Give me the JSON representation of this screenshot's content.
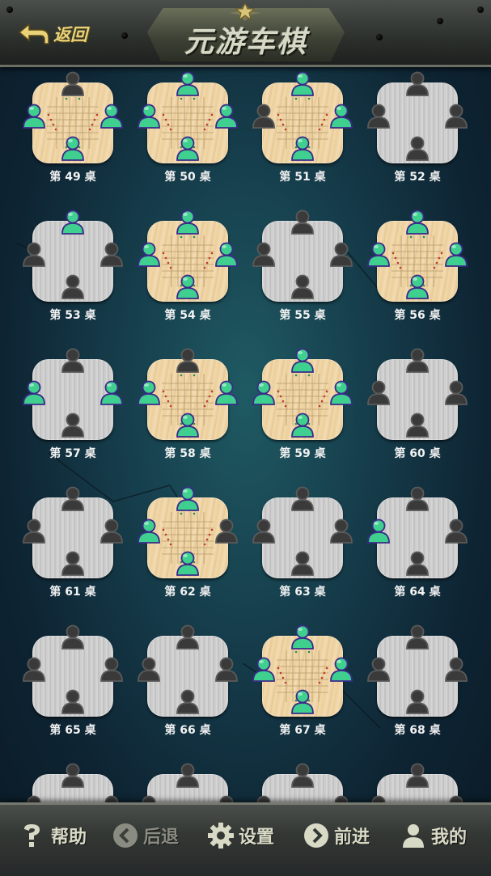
{
  "header": {
    "back_label": "返回",
    "title": "元游车棋"
  },
  "tables": [
    {
      "label": "第 49 桌",
      "board": "wood",
      "seats": {
        "top": false,
        "left": true,
        "right": true,
        "bottom": true
      }
    },
    {
      "label": "第 50 桌",
      "board": "wood",
      "seats": {
        "top": true,
        "left": true,
        "right": true,
        "bottom": true
      }
    },
    {
      "label": "第 51 桌",
      "board": "wood",
      "seats": {
        "top": true,
        "left": false,
        "right": true,
        "bottom": true
      }
    },
    {
      "label": "第 52 桌",
      "board": "metal",
      "seats": {
        "top": false,
        "left": false,
        "right": false,
        "bottom": false
      }
    },
    {
      "label": "第 53 桌",
      "board": "metal",
      "seats": {
        "top": true,
        "left": false,
        "right": false,
        "bottom": false
      }
    },
    {
      "label": "第 54 桌",
      "board": "wood",
      "seats": {
        "top": true,
        "left": true,
        "right": true,
        "bottom": true
      }
    },
    {
      "label": "第 55 桌",
      "board": "metal",
      "seats": {
        "top": false,
        "left": false,
        "right": false,
        "bottom": false
      }
    },
    {
      "label": "第 56 桌",
      "board": "wood",
      "seats": {
        "top": true,
        "left": true,
        "right": true,
        "bottom": true
      }
    },
    {
      "label": "第 57 桌",
      "board": "metal",
      "seats": {
        "top": false,
        "left": true,
        "right": true,
        "bottom": false
      }
    },
    {
      "label": "第 58 桌",
      "board": "wood",
      "seats": {
        "top": false,
        "left": true,
        "right": true,
        "bottom": true
      }
    },
    {
      "label": "第 59 桌",
      "board": "wood",
      "seats": {
        "top": true,
        "left": true,
        "right": true,
        "bottom": true
      }
    },
    {
      "label": "第 60 桌",
      "board": "metal",
      "seats": {
        "top": false,
        "left": false,
        "right": false,
        "bottom": false
      }
    },
    {
      "label": "第 61 桌",
      "board": "metal",
      "seats": {
        "top": false,
        "left": false,
        "right": false,
        "bottom": false
      }
    },
    {
      "label": "第 62 桌",
      "board": "wood",
      "seats": {
        "top": true,
        "left": true,
        "right": false,
        "bottom": true
      }
    },
    {
      "label": "第 63 桌",
      "board": "metal",
      "seats": {
        "top": false,
        "left": false,
        "right": false,
        "bottom": false
      }
    },
    {
      "label": "第 64 桌",
      "board": "metal",
      "seats": {
        "top": false,
        "left": true,
        "right": false,
        "bottom": false
      }
    },
    {
      "label": "第 65 桌",
      "board": "metal",
      "seats": {
        "top": false,
        "left": false,
        "right": false,
        "bottom": false
      }
    },
    {
      "label": "第 66 桌",
      "board": "metal",
      "seats": {
        "top": false,
        "left": false,
        "right": false,
        "bottom": false
      }
    },
    {
      "label": "第 67 桌",
      "board": "wood",
      "seats": {
        "top": true,
        "left": true,
        "right": true,
        "bottom": true
      }
    },
    {
      "label": "第 68 桌",
      "board": "metal",
      "seats": {
        "top": false,
        "left": false,
        "right": false,
        "bottom": false
      }
    },
    {
      "label": "",
      "board": "metal",
      "seats": {
        "top": false,
        "left": false,
        "right": false,
        "bottom": false
      }
    },
    {
      "label": "",
      "board": "metal",
      "seats": {
        "top": false,
        "left": false,
        "right": false,
        "bottom": false
      }
    },
    {
      "label": "",
      "board": "metal",
      "seats": {
        "top": false,
        "left": false,
        "right": false,
        "bottom": false
      }
    },
    {
      "label": "",
      "board": "metal",
      "seats": {
        "top": false,
        "left": false,
        "right": false,
        "bottom": false
      }
    }
  ],
  "footer": {
    "help_label": "帮助",
    "back_label": "后退",
    "settings_label": "设置",
    "forward_label": "前进",
    "mine_label": "我的"
  },
  "colors": {
    "occupied_seat": "#3fcf8e",
    "empty_seat": "#3a3a3a",
    "accent_gold": "#e9d27a"
  }
}
